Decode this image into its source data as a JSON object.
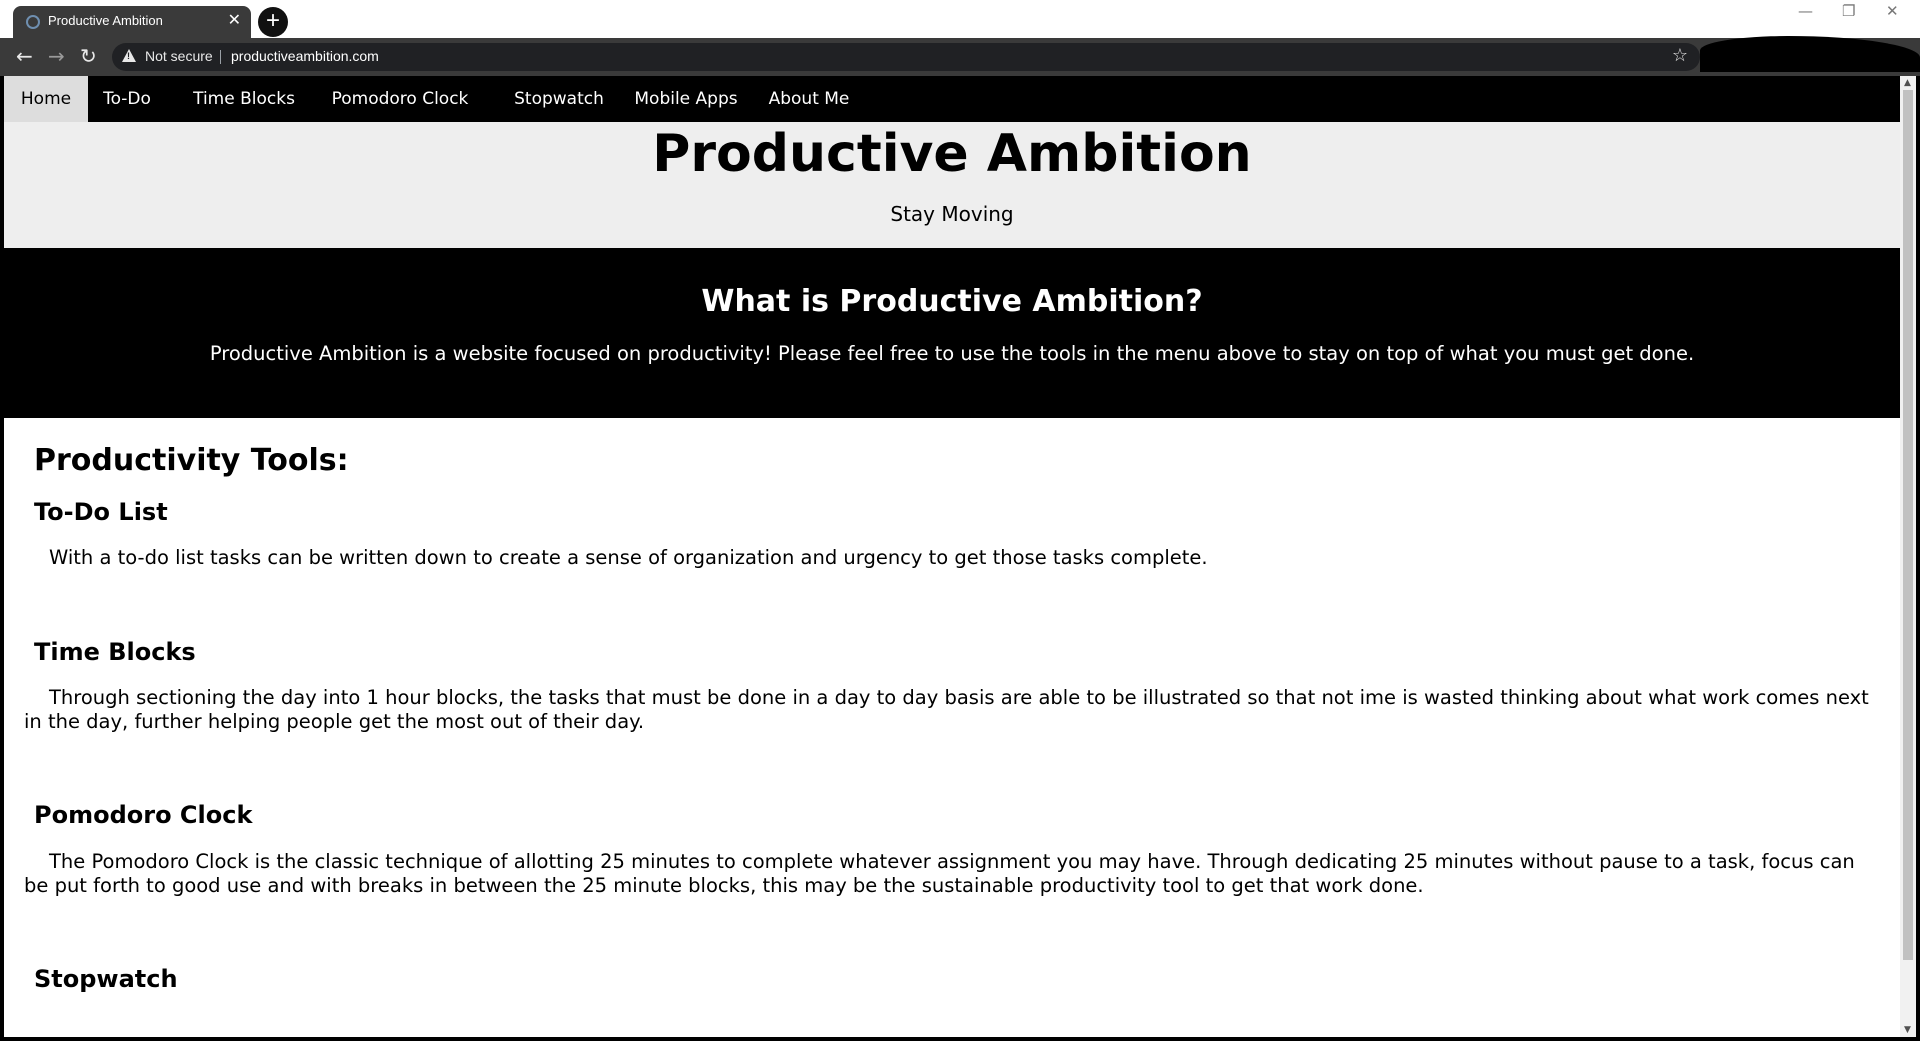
{
  "browser": {
    "tab_title": "Productive Ambition",
    "security_label": "Not secure",
    "url": "productiveambition.com"
  },
  "site": {
    "nav": [
      {
        "label": "Home",
        "active": true
      },
      {
        "label": "To-Do",
        "active": false
      },
      {
        "label": "Time Blocks",
        "active": false
      },
      {
        "label": "Pomodoro Clock",
        "active": false
      },
      {
        "label": "Stopwatch",
        "active": false
      },
      {
        "label": "Mobile Apps",
        "active": false
      },
      {
        "label": "About Me",
        "active": false
      }
    ],
    "hero": {
      "title": "Productive Ambition",
      "subtitle": "Stay Moving"
    },
    "about": {
      "title": "What is Productive Ambition?",
      "text": "Productive Ambition is a website focused on productivity! Please feel free to use the tools in the menu above to stay on top of what you must get done."
    },
    "tools": {
      "heading": "Productivity Tools:",
      "items": [
        {
          "title": "To-Do List",
          "description": "With a to-do list tasks can be written down to create a sense of organization and urgency to get those tasks complete."
        },
        {
          "title": "Time Blocks",
          "description": "Through sectioning the day into 1 hour blocks, the tasks that must be done in a day to day basis are able to be illustrated so that not ime is wasted thinking about what work comes next in the day, further helping people get the most out of their day."
        },
        {
          "title": "Pomodoro Clock",
          "description": "The Pomodoro Clock is the classic technique of allotting 25 minutes to complete whatever assignment you may have. Through dedicating 25 minutes without pause to a task, focus can be put forth to good use and with breaks in between the 25 minute blocks, this may be the sustainable productivity tool to get that work done."
        },
        {
          "title": "Stopwatch",
          "description": ""
        }
      ]
    }
  },
  "colors": {
    "nav_bg": "#000000",
    "nav_active_bg": "#dddddd",
    "hero_bg": "#eeeeee",
    "about_bg": "#000000"
  }
}
